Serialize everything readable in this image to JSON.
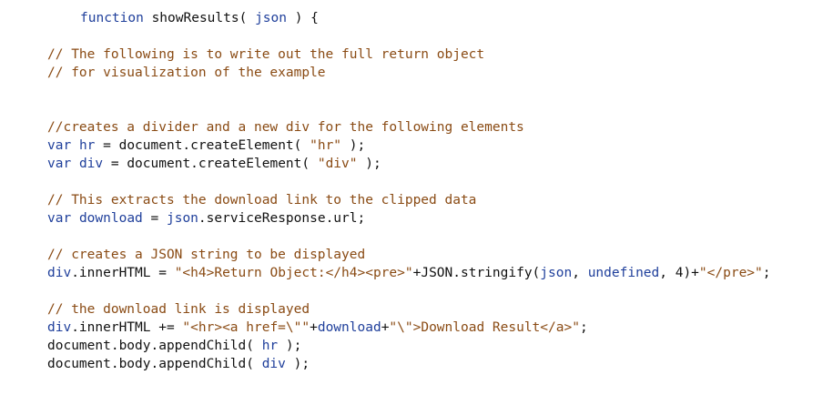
{
  "code": {
    "l1": {
      "kw": "function",
      "plain1": " showResults( ",
      "param": "json",
      "plain2": " ) {"
    },
    "l2": {
      "comment": "// The following is to write out the full return object"
    },
    "l3": {
      "comment": "// for visualization of the example"
    },
    "l4": {
      "comment": "//creates a divider and a new div for the following elements"
    },
    "l5": {
      "kw": "var",
      "plain1": " ",
      "ident": "hr",
      "plain2": " = document.createElement( ",
      "str": "\"hr\"",
      "plain3": " );"
    },
    "l6": {
      "kw": "var",
      "plain1": " ",
      "ident": "div",
      "plain2": " = document.createElement( ",
      "str": "\"div\"",
      "plain3": " );"
    },
    "l7": {
      "comment": "// This extracts the download link to the clipped data"
    },
    "l8": {
      "kw": "var",
      "plain1": " ",
      "ident": "download",
      "plain2": " = ",
      "ident2": "json",
      "plain3": ".serviceResponse.url;"
    },
    "l9": {
      "comment": "// creates a JSON string to be displayed"
    },
    "l10": {
      "ident": "div",
      "plain1": ".innerHTML = ",
      "str1": "\"<h4>Return Object:</h4><pre>\"",
      "plain2": "+JSON.stringify(",
      "ident2": "json",
      "plain3": ", ",
      "ident3": "undefined",
      "plain4": ", 4)+",
      "str2": "\"</pre>\"",
      "plain5": ";"
    },
    "l11": {
      "comment": "// the download link is displayed"
    },
    "l12": {
      "ident": "div",
      "plain1": ".innerHTML += ",
      "str1": "\"<hr><a href=\\\"\"",
      "plain2": "+",
      "ident2": "download",
      "plain3": "+",
      "str2": "\"\\\">Download Result</a>\"",
      "plain4": ";"
    },
    "l13": {
      "plain1": "document.body.appendChild( ",
      "ident": "hr",
      "plain2": " );"
    },
    "l14": {
      "plain1": "document.body.appendChild( ",
      "ident": "div",
      "plain2": " );"
    }
  },
  "colors": {
    "keyword": "#1f3f9b",
    "comment": "#8a4b14",
    "string": "#8a4b14",
    "text": "#111111",
    "background": "#ffffff"
  }
}
